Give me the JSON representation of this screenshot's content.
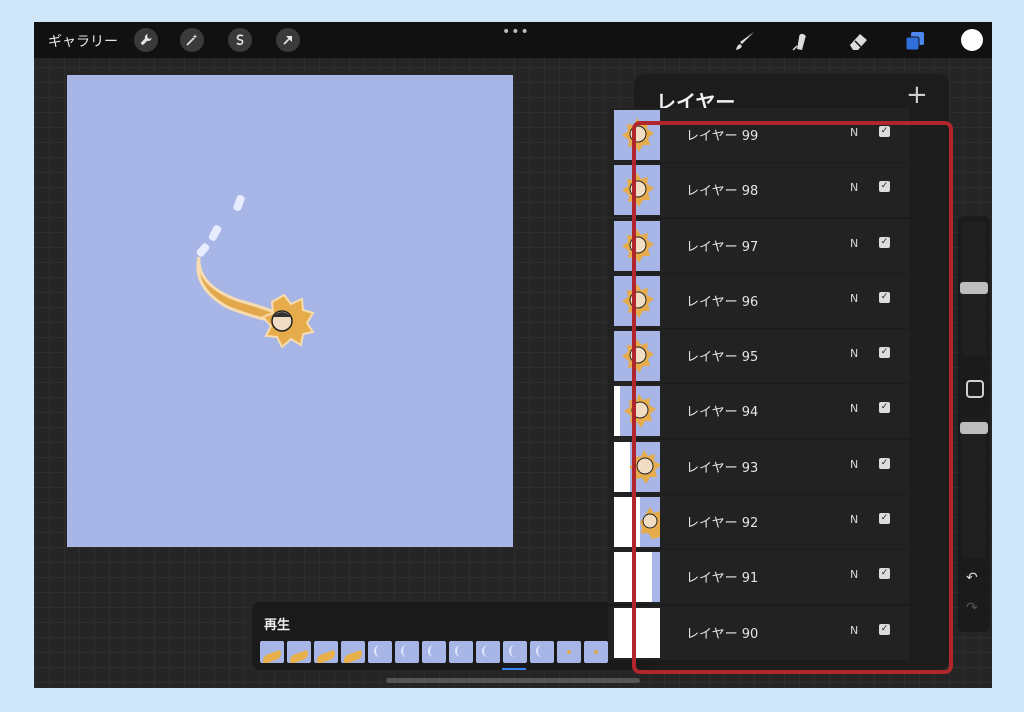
{
  "topbar": {
    "gallery_label": "ギャラリー",
    "left_tools": [
      "wrench-icon",
      "magic-wand-icon",
      "selection-icon",
      "transform-arrow-icon"
    ],
    "right_tools": [
      "brush-icon",
      "smudge-icon",
      "eraser-icon",
      "layers-icon"
    ],
    "active_color": "#ffffff",
    "more_label": "•••"
  },
  "colors": {
    "canvas": "#a7b6e6",
    "accent": "#2f6fdc",
    "highlight": "#b0262c"
  },
  "layers_panel": {
    "title": "レイヤー",
    "add_label": "+",
    "layers": [
      {
        "name": "レイヤー 99",
        "mode": "N",
        "visible": true
      },
      {
        "name": "レイヤー 98",
        "mode": "N",
        "visible": true
      },
      {
        "name": "レイヤー 97",
        "mode": "N",
        "visible": true
      },
      {
        "name": "レイヤー 96",
        "mode": "N",
        "visible": true
      },
      {
        "name": "レイヤー 95",
        "mode": "N",
        "visible": true
      },
      {
        "name": "レイヤー 94",
        "mode": "N",
        "visible": true
      },
      {
        "name": "レイヤー 93",
        "mode": "N",
        "visible": true
      },
      {
        "name": "レイヤー 92",
        "mode": "N",
        "visible": true
      },
      {
        "name": "レイヤー 91",
        "mode": "N",
        "visible": true
      },
      {
        "name": "レイヤー 90",
        "mode": "N",
        "visible": true
      }
    ]
  },
  "timeline": {
    "label": "再生"
  },
  "sidebar": {
    "undo_label": "↶",
    "redo_label": "↷"
  }
}
